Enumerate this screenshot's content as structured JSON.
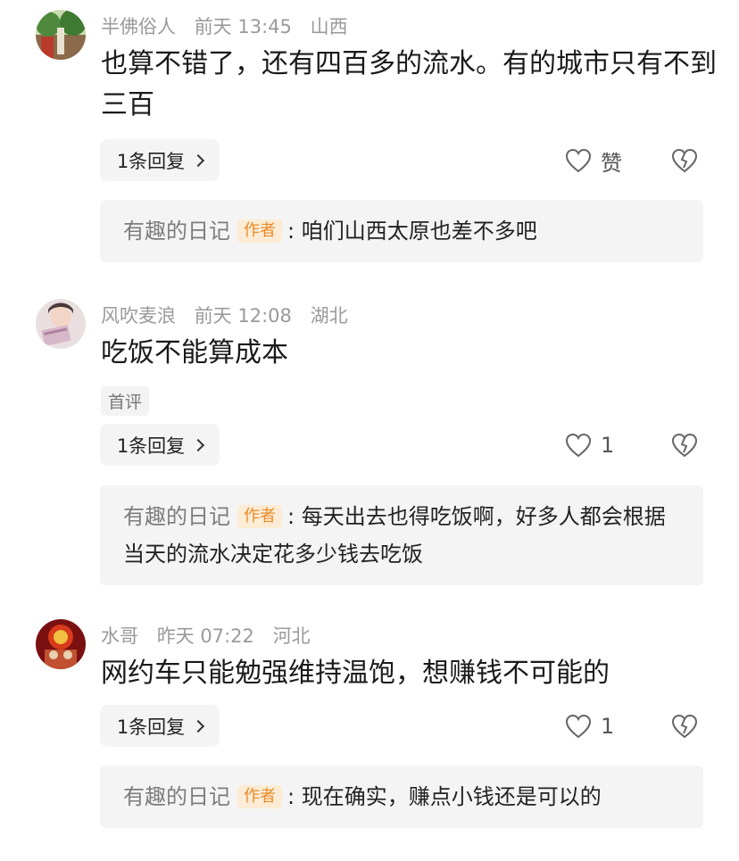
{
  "comments": [
    {
      "user": "半佛俗人",
      "time": "前天 13:45",
      "location": "山西",
      "text": "也算不错了，还有四百多的流水。有的城市只有不到三百",
      "reply_count": "1条回复",
      "like_label": "赞",
      "author_reply": {
        "name": "有趣的日记",
        "badge": "作者",
        "text": ": 咱们山西太原也差不多吧"
      }
    },
    {
      "user": "风吹麦浪",
      "time": "前天 12:08",
      "location": "湖北",
      "text": "吃饭不能算成本",
      "tag": "首评",
      "reply_count": "1条回复",
      "like_label": "1",
      "author_reply": {
        "name": "有趣的日记",
        "badge": "作者",
        "text": ": 每天出去也得吃饭啊，好多人都会根据当天的流水决定花多少钱去吃饭"
      }
    },
    {
      "user": "水哥",
      "time": "昨天 07:22",
      "location": "河北",
      "text": "网约车只能勉强维持温饱，想赚钱不可能的",
      "reply_count": "1条回复",
      "like_label": "1",
      "author_reply": {
        "name": "有趣的日记",
        "badge": "作者",
        "text": ": 现在确实，赚点小钱还是可以的"
      }
    }
  ],
  "icons": {
    "like": "heart-outline-icon",
    "dislike": "broken-heart-icon",
    "more": "chevron-right-icon"
  },
  "colors": {
    "meta": "#9a9a9a",
    "badge_bg": "#fdecd5",
    "badge_text": "#e88c2a",
    "box_bg": "#f4f4f4"
  }
}
